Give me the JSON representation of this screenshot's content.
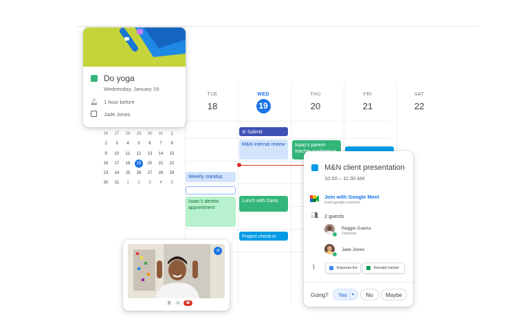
{
  "colors": {
    "accent": "#1a73e8",
    "green": "#33b679",
    "lightblue": "#d2e3fc",
    "lightgreen": "#b7f1cd",
    "blue": "#039be5",
    "red": "#d93025"
  },
  "week": {
    "days": [
      {
        "name": "TUE",
        "num": "18"
      },
      {
        "name": "WED",
        "num": "19"
      },
      {
        "name": "THU",
        "num": "20"
      },
      {
        "name": "FRI",
        "num": "21"
      },
      {
        "name": "SAT",
        "num": "22"
      }
    ]
  },
  "events": {
    "submit": "Submit reimbursem",
    "mn_internal": "M&N internal review",
    "isaac_parent": "Isaac's parent-teacher conference",
    "weekly": "Weekly standup",
    "dentist": "Isaac's dentist appointment",
    "lunch": "Lunch with Dana",
    "project": "Project check-in"
  },
  "yoga": {
    "title": "Do yoga",
    "date": "Wednesday, January 19",
    "reminder": "1 hour before",
    "owner": "Jade Jones"
  },
  "mini_calendar": {
    "rows": [
      [
        "26",
        "27",
        "28",
        "29",
        "30",
        "31",
        "1"
      ],
      [
        "2",
        "3",
        "4",
        "5",
        "6",
        "7",
        "8"
      ],
      [
        "9",
        "10",
        "11",
        "12",
        "13",
        "14",
        "15"
      ],
      [
        "16",
        "17",
        "18",
        "19",
        "20",
        "21",
        "22"
      ],
      [
        "23",
        "24",
        "25",
        "26",
        "27",
        "28",
        "29"
      ],
      [
        "30",
        "31",
        "1",
        "2",
        "3",
        "4",
        "5"
      ]
    ]
  },
  "meeting": {
    "title": "M&N client presentation",
    "time": "10:30 – 11:30 AM",
    "join": "Join with Google Meet",
    "link": "meet.google.com/xvz",
    "guests_label": "2 guests",
    "guests": [
      {
        "name": "Reggie Guerra",
        "role": "Organizer"
      },
      {
        "name": "Jade Jones",
        "role": ""
      }
    ],
    "attachments": [
      "Expense list",
      "Receipt tracker"
    ],
    "going_label": "Going?",
    "yes": "Yes",
    "no": "No",
    "maybe": "Maybe"
  }
}
